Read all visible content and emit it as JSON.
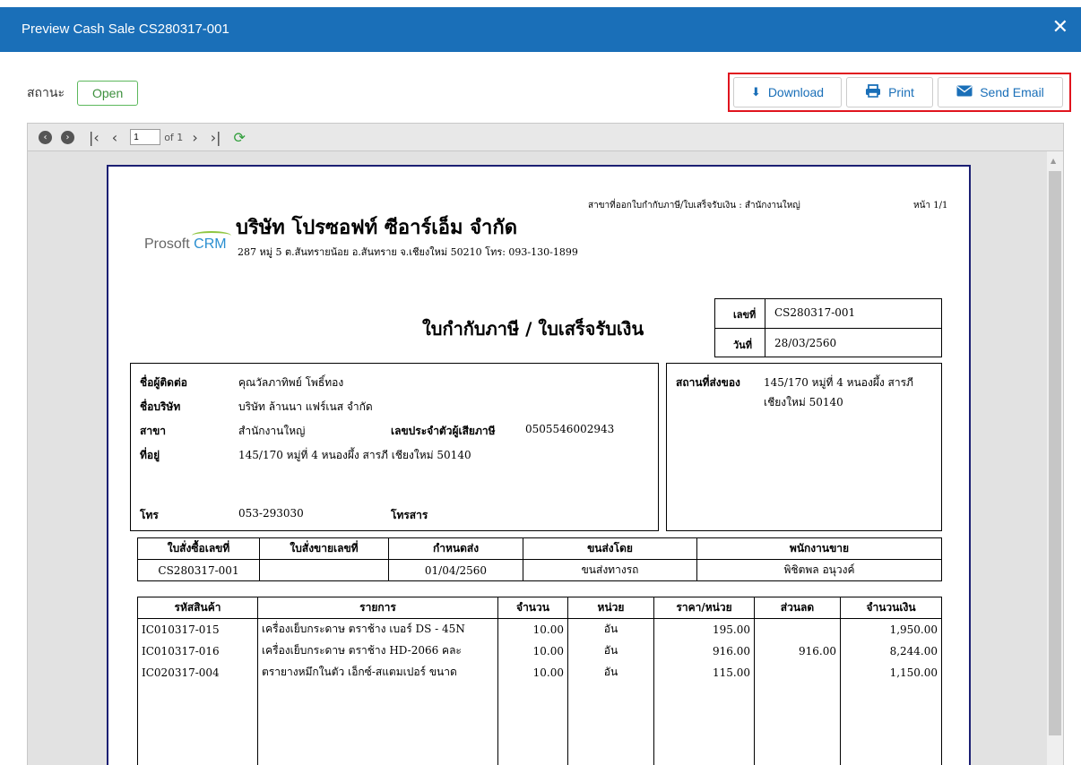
{
  "window": {
    "title": "Preview Cash Sale CS280317-001",
    "close_glyph": "✕"
  },
  "status": {
    "label": "สถานะ",
    "value": "Open"
  },
  "actions": {
    "download": "Download",
    "print": "Print",
    "send_email": "Send Email"
  },
  "toolbar": {
    "page": "1",
    "of_text": "of 1"
  },
  "document": {
    "branch_line": "สาขาที่ออกใบกำกับภาษี/ใบเสร็จรับเงิน : สำนักงานใหญ่",
    "page_no": "หน้า 1/1",
    "company_name": "บริษัท โปรซอฟท์ ซีอาร์เอ็ม จำกัด",
    "company_address": "287 หมู่ 5 ต.สันทรายน้อย อ.สันทราย จ.เชียงใหม่ 50210 โทร: 093-130-1899",
    "logo_text": "Prosoft",
    "logo_crm": "CRM",
    "title": "ใบกำกับภาษี / ใบเสร็จรับเงิน",
    "doc_no_label": "เลขที่",
    "doc_no": "CS280317-001",
    "date_label": "วันที่",
    "date": "28/03/2560",
    "customer": {
      "contact_label": "ชื่อผู้ติดต่อ",
      "contact": "คุณวัลภาทิพย์ โพธิ์ทอง",
      "company_label": "ชื่อบริษัท",
      "company": "บริษัท ล้านนา แฟร์เนส จำกัด",
      "branch_label": "สาขา",
      "branch": "สำนักงานใหญ่",
      "taxid_label": "เลขประจำตัวผู้เสียภาษี",
      "taxid": "0505546002943",
      "address_label": "ที่อยู่",
      "address": "145/170 หมู่ที่ 4 หนองผึ้ง สารภี เชียงใหม่ 50140",
      "phone_label": "โทร",
      "phone": "053-293030",
      "fax_label": "โทรสาร"
    },
    "shipping": {
      "label": "สถานที่ส่งของ",
      "line1": "145/170 หมู่ที่ 4 หนองผึ้ง สารภี",
      "line2": "เชียงใหม่ 50140"
    },
    "order_headers": [
      "ใบสั่งซื้อเลขที่",
      "ใบสั่งขายเลขที่",
      "กำหนดส่ง",
      "ขนส่งโดย",
      "พนักงานขาย"
    ],
    "order_row": [
      "CS280317-001",
      "",
      "01/04/2560",
      "ขนส่งทางรถ",
      "พิชิตพล อนุวงค์"
    ],
    "item_headers": [
      "รหัสสินค้า",
      "รายการ",
      "จำนวน",
      "หน่วย",
      "ราคา/หน่วย",
      "ส่วนลด",
      "จำนวนเงิน"
    ],
    "items": [
      [
        "IC010317-015",
        "เครื่องเย็บกระดาษ ตราช้าง เบอร์ DS - 45N",
        "10.00",
        "อัน",
        "195.00",
        "",
        "1,950.00"
      ],
      [
        "IC010317-016",
        "เครื่องเย็บกระดาษ ตราช้าง HD-2066 คละ",
        "10.00",
        "อัน",
        "916.00",
        "916.00",
        "8,244.00"
      ],
      [
        "IC020317-004",
        "ตรายางหมึกในตัว เอ็กซ์-สแตมเปอร์ ขนาด",
        "10.00",
        "อัน",
        "115.00",
        "",
        "1,150.00"
      ]
    ]
  }
}
